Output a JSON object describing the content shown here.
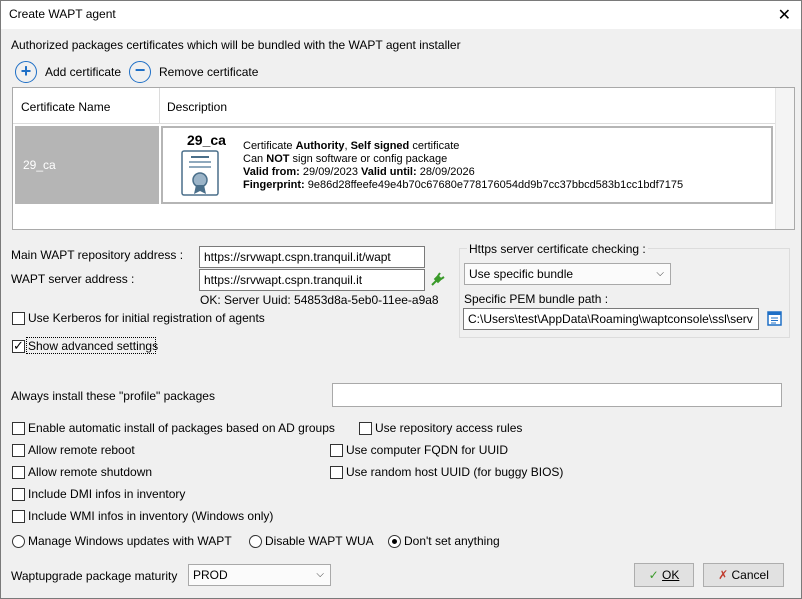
{
  "window": {
    "title": "Create WAPT agent",
    "close_glyph": "✕"
  },
  "certs": {
    "section_label": "Authorized packages certificates which will be bundled with the WAPT agent installer",
    "add_label": "Add certificate",
    "remove_label": "Remove certificate",
    "columns": [
      "Certificate Name",
      "Description"
    ],
    "rows": [
      {
        "name": "29_ca",
        "title": "29_ca",
        "line1_a": "Certificate ",
        "line1_b": "Authority",
        "line1_c": ", ",
        "line1_d": "Self signed",
        "line1_e": " certificate",
        "line2_a": "Can ",
        "line2_b": "NOT",
        "line2_c": " sign software or config package",
        "valid_from_label": "Valid from:",
        "valid_from": " 29/09/2023 ",
        "valid_until_label": "Valid until:",
        "valid_until": " 28/09/2026",
        "fingerprint_label": "Fingerprint:",
        "fingerprint": " 9e86d28ffeefe49e4b70c67680e778176054dd9b7cc37bbcd583b1cc1bdf7175"
      }
    ]
  },
  "server": {
    "repo_label": "Main WAPT repository address :",
    "repo_value": "https://srvwapt.cspn.tranquil.it/wapt",
    "server_label": "WAPT server address :",
    "server_value": "https://srvwapt.cspn.tranquil.it",
    "status": "OK: Server Uuid: 54853d8a-5eb0-11ee-a9a8",
    "kerberos_label": "Use Kerberos for initial registration of agents",
    "advanced_label": "Show advanced settings"
  },
  "https": {
    "group_label": "Https server certificate checking :",
    "mode_value": "Use specific bundle",
    "pem_label": "Specific PEM bundle path :",
    "pem_value": "C:\\Users\\test\\AppData\\Roaming\\waptconsole\\ssl\\serv"
  },
  "advanced": {
    "profile_label": "Always install these \"profile\" packages",
    "profile_value": "",
    "ad_groups_label": "Enable automatic install of packages based on AD groups",
    "repo_rules_label": "Use repository access rules",
    "remote_reboot_label": "Allow remote reboot",
    "fqdn_label": "Use computer FQDN for UUID",
    "remote_shutdown_label": "Allow remote shutdown",
    "random_uuid_label": "Use random host UUID (for buggy BIOS)",
    "dmi_label": "Include DMI infos in inventory",
    "wmi_label": "Include WMI infos in inventory (Windows only)",
    "radio_manage_label": "Manage Windows updates with WAPT",
    "radio_disable_label": "Disable WAPT WUA",
    "radio_dont_label": "Don't set anything",
    "maturity_label": "Waptupgrade package maturity",
    "maturity_value": "PROD"
  },
  "buttons": {
    "ok_label": "OK",
    "cancel_label": "Cancel"
  },
  "colors": {
    "accent_blue": "#1e6fc6",
    "selected_row": "#b5b5b5",
    "ok_green": "#3a9a2a",
    "cancel_red": "#c0392b"
  }
}
